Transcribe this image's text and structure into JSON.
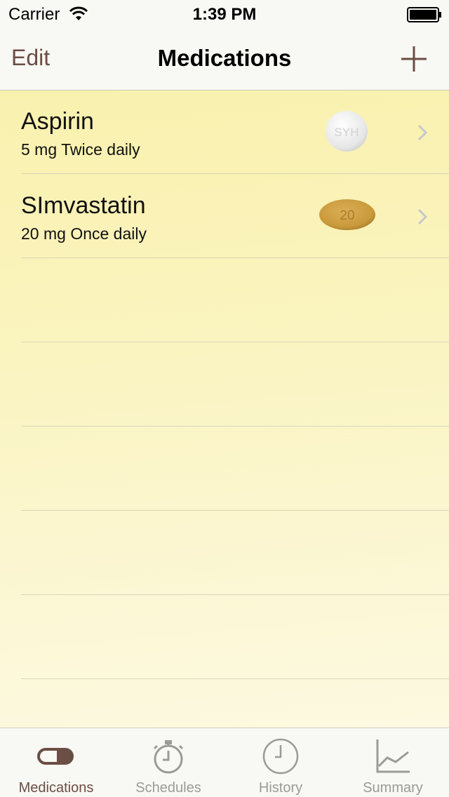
{
  "status_bar": {
    "carrier": "Carrier",
    "time": "1:39 PM",
    "wifi_icon": "wifi-icon",
    "battery_icon": "battery-icon"
  },
  "nav": {
    "edit_label": "Edit",
    "title": "Medications",
    "add_icon": "plus-icon"
  },
  "medications": [
    {
      "name": "Aspirin",
      "dose": "5 mg Twice daily",
      "pill_imprint": "SYH",
      "pill_color": "#eeeeee"
    },
    {
      "name": "SImvastatin",
      "dose": "20 mg Once daily",
      "pill_imprint": "20",
      "pill_color": "#c99a3c"
    }
  ],
  "tabs": [
    {
      "label": "Medications",
      "icon": "pill-icon",
      "active": true
    },
    {
      "label": "Schedules",
      "icon": "stopwatch-icon",
      "active": false
    },
    {
      "label": "History",
      "icon": "clock-icon",
      "active": false
    },
    {
      "label": "Summary",
      "icon": "chart-icon",
      "active": false
    }
  ],
  "colors": {
    "accent": "#6b4e44",
    "tab_inactive": "#9a9a98",
    "background": "#faf3bb"
  }
}
